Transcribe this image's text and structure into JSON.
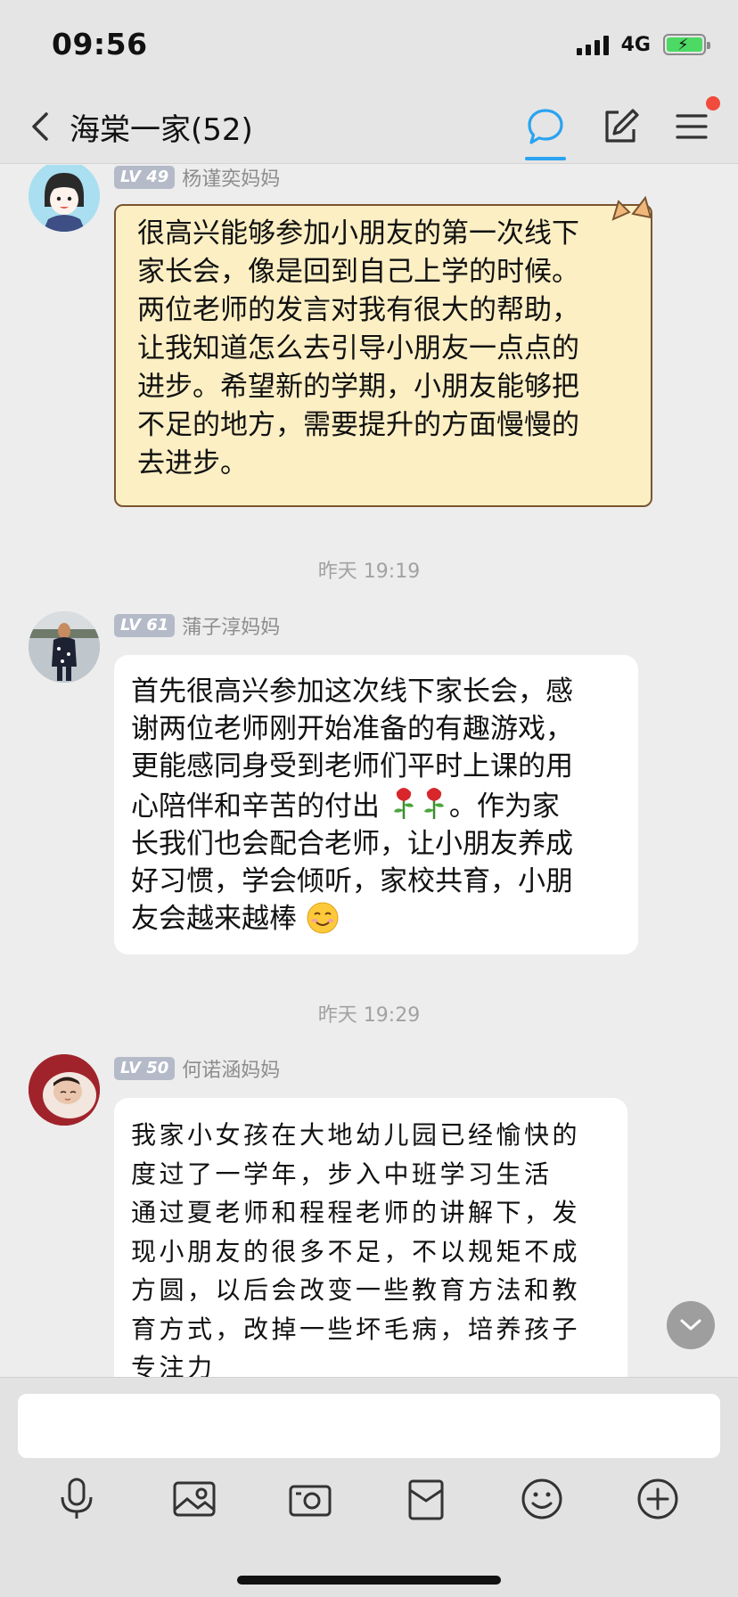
{
  "status_bar": {
    "time": "09:56",
    "network": "4G"
  },
  "header": {
    "title": "海棠一家(52)"
  },
  "messages": [
    {
      "level": "LV 49",
      "sender": "杨谨奕妈妈",
      "lines": [
        "很高兴能够参加小朋友的第一次线下",
        "家长会，像是回到自己上学的时候。",
        "两位老师的发言对我有很大的帮助，",
        "让我知道怎么去引导小朋友一点点的",
        "进步。希望新的学期，小朋友能够把",
        "不足的地方，需要提升的方面慢慢的",
        "去进步。"
      ]
    },
    {
      "time": "昨天 19:19",
      "level": "LV 61",
      "sender": "蒲子淳妈妈",
      "lines": [
        "首先很高兴参加这次线下家长会，感",
        "谢两位老师刚开始准备的有趣游戏，",
        "更能感同身受到老师们平时上课的用",
        "心陪伴和辛苦的付出",
        "。作为家",
        "长我们也会配合老师，让小朋友养成",
        "好习惯，学会倾听，家校共育，小朋",
        "友会越来越棒"
      ]
    },
    {
      "time": "昨天 19:29",
      "level": "LV 50",
      "sender": "何诺涵妈妈",
      "lines": [
        "我家小女孩在大地幼儿园已经愉快的",
        "度过了一学年，步入中班学习生活",
        "通过夏老师和程程老师的讲解下，发",
        "现小朋友的很多不足，不以规矩不成",
        "方圆，以后会改变一些教育方法和教",
        "育方式，改掉一些坏毛病，培养孩子",
        "专注力"
      ]
    }
  ],
  "input": {
    "placeholder": "",
    "value": ""
  },
  "toolbar": [
    "mic-icon",
    "photo-icon",
    "camera-icon",
    "red-packet-icon",
    "emoji-icon",
    "plus-icon"
  ],
  "colors": {
    "accent": "#2aa3f0",
    "themed_bubble": "#fcefc4",
    "badge": "#b4bac8",
    "notification_dot": "#f04b3c"
  }
}
